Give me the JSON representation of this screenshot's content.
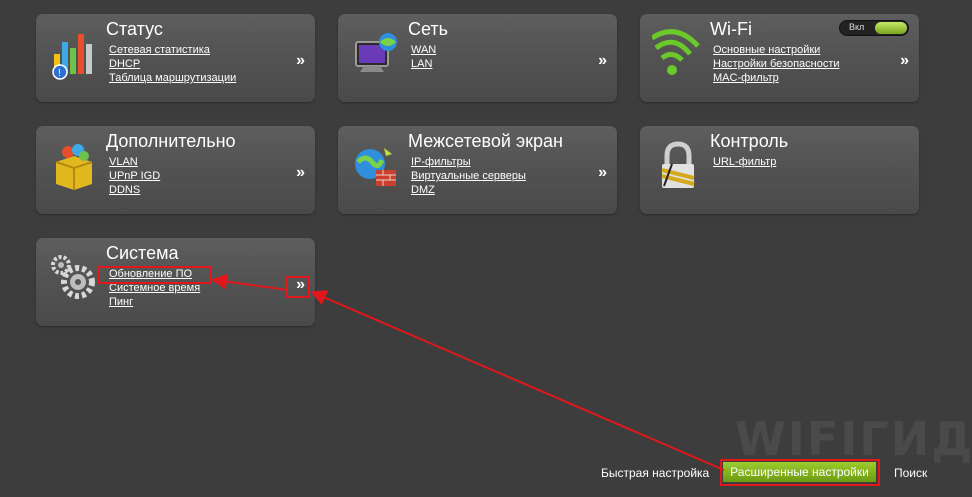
{
  "cards": {
    "status": {
      "title": "Статус",
      "links": [
        "Сетевая статистика",
        "DHCP",
        "Таблица маршрутизации"
      ],
      "more": "»"
    },
    "network": {
      "title": "Сеть",
      "links": [
        "WAN",
        "LAN"
      ],
      "more": "»"
    },
    "wifi": {
      "title": "Wi-Fi",
      "links": [
        "Основные настройки",
        "Настройки безопасности",
        "MAC-фильтр"
      ],
      "more": "»",
      "toggle_label": "Вкл"
    },
    "advanced": {
      "title": "Дополнительно",
      "links": [
        "VLAN",
        "UPnP IGD",
        "DDNS"
      ],
      "more": "»"
    },
    "firewall": {
      "title": "Межсетевой экран",
      "links": [
        "IP-фильтры",
        "Виртуальные серверы",
        "DMZ"
      ],
      "more": "»"
    },
    "control": {
      "title": "Контроль",
      "links": [
        "URL-фильтр"
      ]
    },
    "system": {
      "title": "Система",
      "links": [
        "Обновление ПО",
        "Системное время",
        "Пинг"
      ],
      "more": "»"
    }
  },
  "footer": {
    "quick": "Быстрая настройка",
    "advanced": "Расширенные настройки",
    "search": "Поиск"
  },
  "watermark": "WIFIГИД",
  "colors": {
    "annotation": "#e0181c",
    "accent_green": "#8cbf26"
  },
  "icons": {
    "status": "chart-icon",
    "network": "monitor-globe-icon",
    "wifi": "wifi-icon",
    "advanced": "gift-box-icon",
    "firewall": "globe-brick-icon",
    "control": "padlock-icon",
    "system": "gears-icon"
  }
}
